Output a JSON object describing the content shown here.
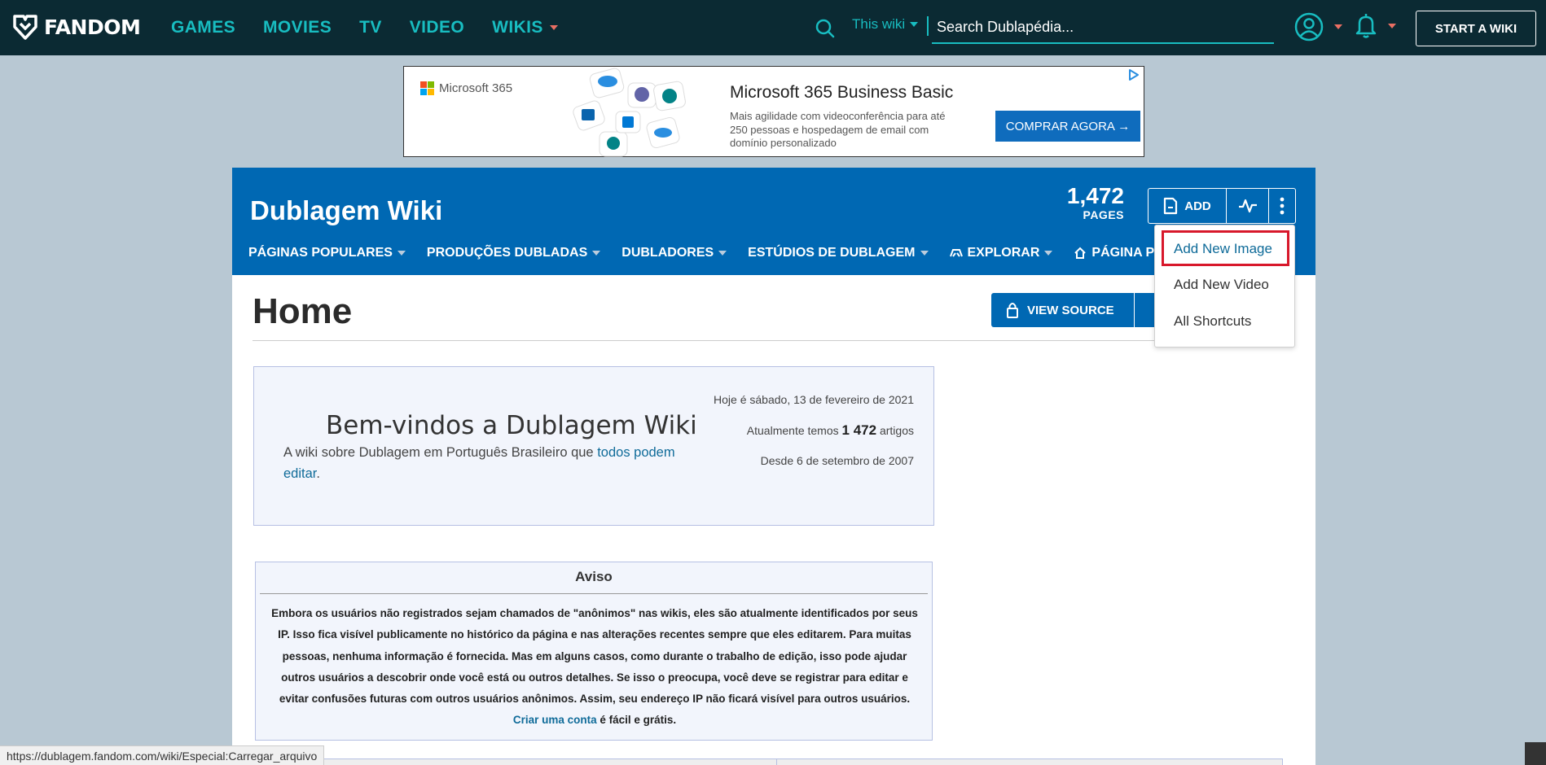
{
  "global_nav": {
    "logo": "FANDOM",
    "links": [
      {
        "label": "GAMES"
      },
      {
        "label": "MOVIES"
      },
      {
        "label": "TV"
      },
      {
        "label": "VIDEO"
      },
      {
        "label": "WIKIS",
        "has_caret": true
      }
    ],
    "search_scope": "This wiki",
    "search_placeholder": "Search Dublapédia...",
    "start_wiki": "START A WIKI"
  },
  "ad": {
    "brand": "Microsoft 365",
    "title": "Microsoft 365 Business Basic",
    "text": "Mais agilidade com videoconferência para até 250 pessoas e hospedagem de email com domínio personalizado",
    "cta": "COMPRAR AGORA →"
  },
  "wiki": {
    "title": "Dublagem Wiki",
    "pages_count": "1,472",
    "pages_label": "PAGES",
    "add_label": "ADD",
    "nav": [
      {
        "label": "PÁGINAS POPULARES"
      },
      {
        "label": "PRODUÇÕES DUBLADAS"
      },
      {
        "label": "DUBLADORES"
      },
      {
        "label": "ESTÚDIOS DE DUBLAGEM"
      },
      {
        "label": "EXPLORAR"
      },
      {
        "label": "PÁGINA PRINC"
      }
    ]
  },
  "add_menu": {
    "items": [
      "Add New Image",
      "Add New Video",
      "All Shortcuts"
    ]
  },
  "page": {
    "title": "Home",
    "view_source": "VIEW SOURCE"
  },
  "welcome": {
    "title": "Bem-vindos a Dublagem Wiki",
    "text_before": "A wiki sobre Dublagem em Português Brasileiro que ",
    "link": "todos podem editar",
    "text_after": ".",
    "date_line": "Hoje é sábado, 13 de fevereiro de 2021",
    "count_prefix": "Atualmente temos ",
    "count": "1 472",
    "count_suffix": " artigos",
    "since": "Desde 6 de setembro de 2007"
  },
  "aviso": {
    "title": "Aviso",
    "text": "Embora os usuários não registrados sejam chamados de \"anônimos\" nas wikis, eles são atualmente identificados por seus IP. Isso fica visível publicamente no histórico da página e nas alterações recentes sempre que eles editarem. Para muitas pessoas, nenhuma informação é fornecida. Mas em alguns casos, como durante o trabalho de edição, isso pode ajudar outros usuários a descobrir onde você está ou outros detalhes. Se isso o preocupa, você deve se registrar para editar e evitar confusões futuras com outros usuários anônimos. Assim, seu endereço IP não ficará visível para outros usuários. ",
    "link": "Criar uma conta",
    "text_end": " é fácil e grátis."
  },
  "status_url": "https://dublagem.fandom.com/wiki/Especial:Carregar_arquivo",
  "colors": {
    "global_nav_bg": "#0b2a33",
    "accent_teal": "#18bdc1",
    "wiki_blue": "#0068b3",
    "highlight_red": "#d8182b"
  }
}
